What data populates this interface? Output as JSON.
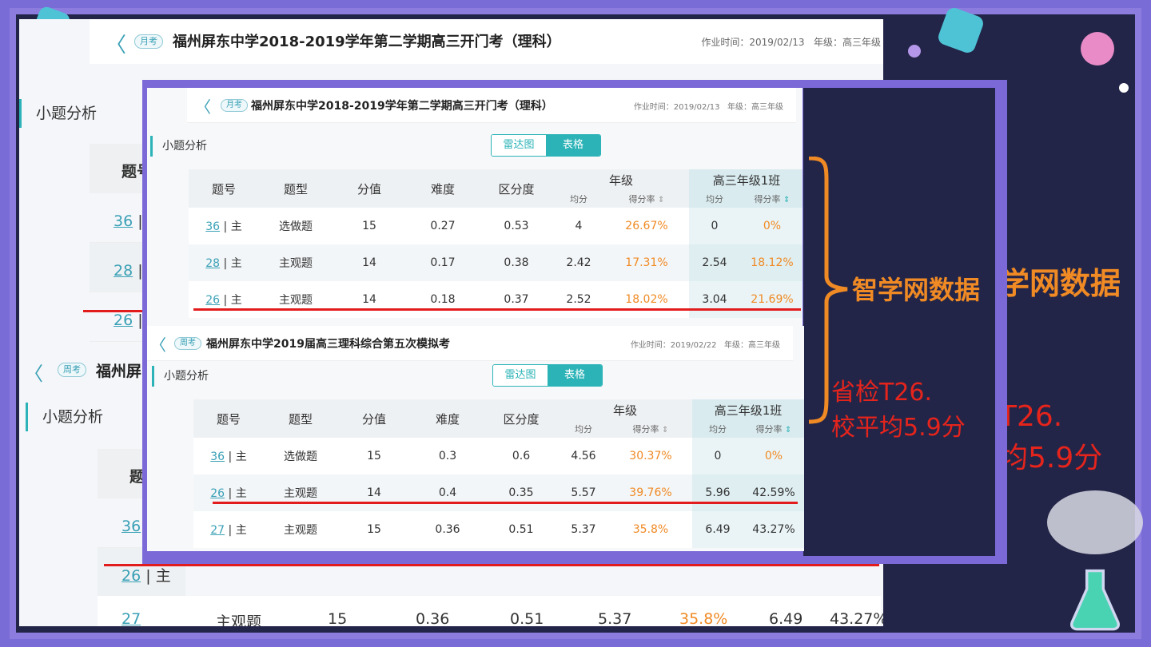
{
  "exam1": {
    "back": "〈",
    "badge": "月考",
    "title": "福州屏东中学2018-2019学年第二学期高三开门考（理科）",
    "time": "作业时间：2019/02/13",
    "grade": "年级：高三年级"
  },
  "exam2": {
    "back": "〈",
    "badge": "周考",
    "title": "福州屏东中学2019届高三理科综合第五次模拟考",
    "time": "作业时间：2019/02/22",
    "grade": "年级：高三年级"
  },
  "section_title": "小题分析",
  "toggle": {
    "radar": "雷达图",
    "table": "表格"
  },
  "columns": {
    "qno": "题号",
    "qtype": "题型",
    "score": "分值",
    "difficulty": "难度",
    "discrimination": "区分度",
    "grade_group": "年级",
    "class_group": "高三年级1班",
    "avg": "均分",
    "rate": "得分率"
  },
  "sort_icon": "⇕",
  "table1": [
    {
      "no": "36",
      "kind": "主",
      "type": "选做题",
      "score": "15",
      "diff": "0.27",
      "disc": "0.53",
      "g_avg": "4",
      "g_rate": "26.67%",
      "c_avg": "0",
      "c_rate": "0%"
    },
    {
      "no": "28",
      "kind": "主",
      "type": "主观题",
      "score": "14",
      "diff": "0.17",
      "disc": "0.38",
      "g_avg": "2.42",
      "g_rate": "17.31%",
      "c_avg": "2.54",
      "c_rate": "18.12%"
    },
    {
      "no": "26",
      "kind": "主",
      "type": "主观题",
      "score": "14",
      "diff": "0.18",
      "disc": "0.37",
      "g_avg": "2.52",
      "g_rate": "18.02%",
      "c_avg": "3.04",
      "c_rate": "21.69%"
    }
  ],
  "table2": [
    {
      "no": "36",
      "kind": "主",
      "type": "选做题",
      "score": "15",
      "diff": "0.3",
      "disc": "0.6",
      "g_avg": "4.56",
      "g_rate": "30.37%",
      "c_avg": "0",
      "c_rate": "0%"
    },
    {
      "no": "26",
      "kind": "主",
      "type": "主观题",
      "score": "14",
      "diff": "0.4",
      "disc": "0.35",
      "g_avg": "5.57",
      "g_rate": "39.76%",
      "c_avg": "5.96",
      "c_rate": "42.59%"
    },
    {
      "no": "27",
      "kind": "主",
      "type": "主观题",
      "score": "15",
      "diff": "0.36",
      "disc": "0.51",
      "g_avg": "5.37",
      "g_rate": "35.8%",
      "c_avg": "6.49",
      "c_rate": "43.27%"
    }
  ],
  "annotation": {
    "source": "智学网数据",
    "source_bg": "学网数据",
    "note_line1": "省检T26.",
    "note_line2": "校平均5.9分",
    "note_bg1": "T26.",
    "note_bg2": "均5.9分"
  },
  "bg_fragments": {
    "title1": "福州屏东中学2018-2019学年第二学期高三开门考（理科）",
    "title2": "福州屏",
    "sep": "|",
    "last_row": [
      "27",
      "主",
      "主观题",
      "15",
      "0.36",
      "0.51",
      "5.37",
      "35.8%",
      "6.49",
      "43.27%"
    ]
  },
  "colors": {
    "accent": "#2bb3b7",
    "rate": "#f08a24",
    "highlight": "#e21c1c",
    "frame": "#7a6cd6"
  }
}
